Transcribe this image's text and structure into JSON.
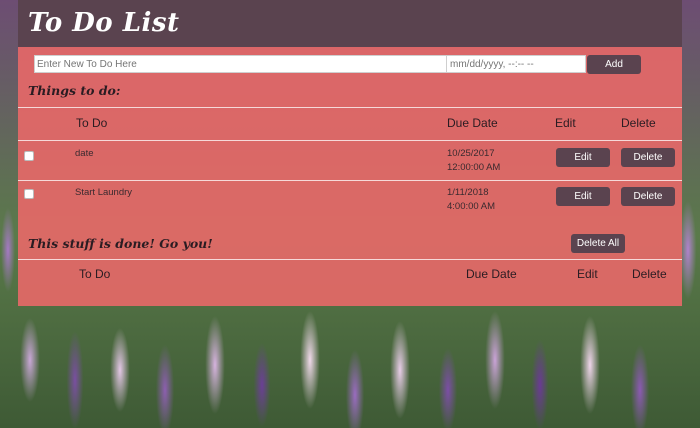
{
  "header": {
    "title": "To Do List"
  },
  "form": {
    "todo_placeholder": "Enter New To Do Here",
    "date_placeholder": "mm/dd/yyyy, --:-- --",
    "add_label": "Add"
  },
  "todo_section": {
    "title": "Things to do:",
    "columns": {
      "todo": "To Do",
      "due": "Due Date",
      "edit": "Edit",
      "delete": "Delete"
    },
    "rows": [
      {
        "text": "date",
        "due_date": "10/25/2017",
        "due_time": "12:00:00 AM",
        "checked": false,
        "edit_label": "Edit",
        "delete_label": "Delete"
      },
      {
        "text": "Start Laundry",
        "due_date": "1/11/2018",
        "due_time": "4:00:00 AM",
        "checked": false,
        "edit_label": "Edit",
        "delete_label": "Delete"
      }
    ]
  },
  "done_section": {
    "title": "This stuff is done! Go you!",
    "delete_all_label": "Delete All",
    "columns": {
      "todo": "To Do",
      "due": "Due Date",
      "edit": "Edit",
      "delete": "Delete"
    }
  },
  "colors": {
    "header_bg": "#5a434f",
    "panel_bg": "#e86868",
    "button_bg": "#5a434f"
  }
}
